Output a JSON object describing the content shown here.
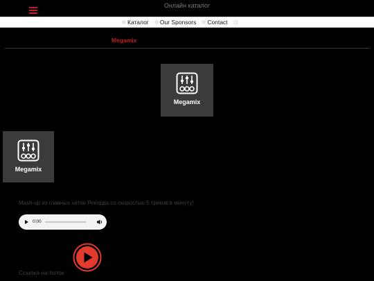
{
  "header": {
    "site_title": "Онлайн каталог"
  },
  "nav": {
    "items": [
      {
        "label": "Каталог"
      },
      {
        "label": "Our Sponsors"
      },
      {
        "label": "Contact"
      }
    ]
  },
  "page": {
    "title": "Megamix"
  },
  "tiles": [
    {
      "label": "Megamix",
      "icon": "equalizer-icon"
    },
    {
      "label": "Megamix",
      "icon": "equalizer-icon"
    }
  ],
  "description": "Mash-up из главных хитов Рекорда со скоростью 5 треков в минуту!",
  "player": {
    "time": "0:00"
  },
  "stream_link": {
    "label": "Ссылка на поток"
  },
  "colors": {
    "accent": "#c0201e",
    "tile_bg": "#3b3b3b",
    "play_button": "#e23b2e"
  }
}
